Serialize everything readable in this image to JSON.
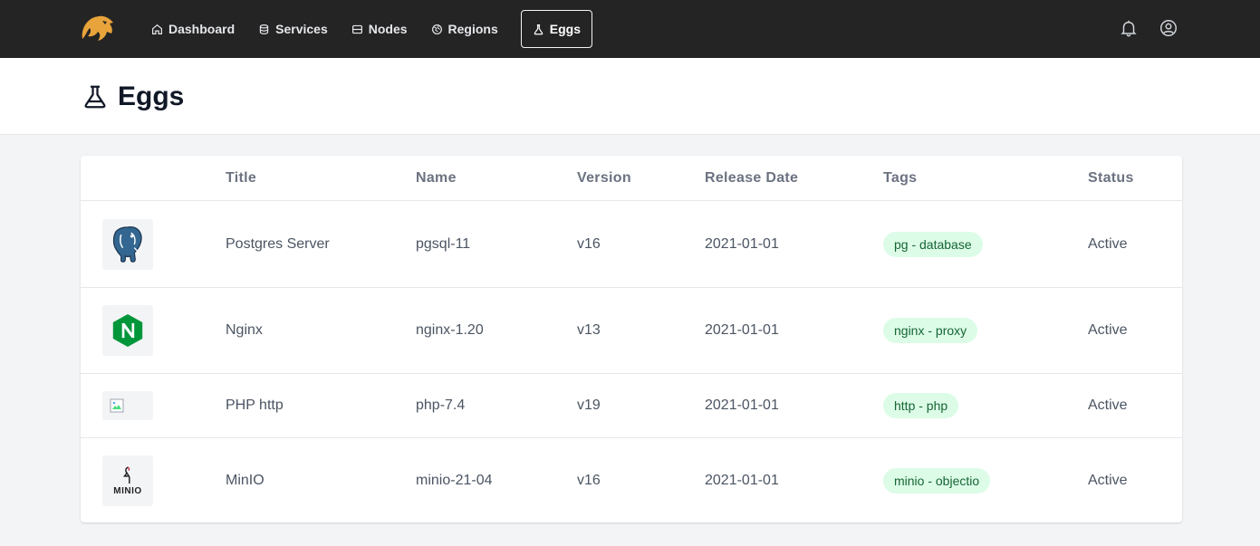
{
  "nav": {
    "logo_icon": "lion-logo-icon",
    "items": [
      {
        "label": "Dashboard",
        "icon": "home-icon"
      },
      {
        "label": "Services",
        "icon": "database-icon"
      },
      {
        "label": "Nodes",
        "icon": "server-icon"
      },
      {
        "label": "Regions",
        "icon": "globe-icon"
      },
      {
        "label": "Eggs",
        "icon": "flask-icon",
        "active": true
      }
    ],
    "right_icons": [
      "bell-icon",
      "user-circle-icon"
    ]
  },
  "page": {
    "title": "Eggs",
    "title_icon": "flask-icon"
  },
  "table": {
    "headers": {
      "title": "Title",
      "name": "Name",
      "version": "Version",
      "release_date": "Release Date",
      "tags": "Tags",
      "status": "Status"
    },
    "rows": [
      {
        "icon": "postgres-elephant-icon",
        "title": "Postgres Server",
        "name": "pgsql-11",
        "version": "v16",
        "release_date": "2021-01-01",
        "tag": "pg - database",
        "status": "Active"
      },
      {
        "icon": "nginx-logo-icon",
        "title": "Nginx",
        "name": "nginx-1.20",
        "version": "v13",
        "release_date": "2021-01-01",
        "tag": "nginx - proxy",
        "status": "Active"
      },
      {
        "icon": "broken-image-icon",
        "title": "PHP http",
        "name": "php-7.4",
        "version": "v19",
        "release_date": "2021-01-01",
        "tag": "http - php",
        "status": "Active"
      },
      {
        "icon": "minio-logo-icon",
        "title": "MinIO",
        "name": "minio-21-04",
        "version": "v16",
        "release_date": "2021-01-01",
        "tag": "minio - objectio",
        "status": "Active",
        "logo_text": "MINIO"
      }
    ]
  },
  "colors": {
    "navbar": "#242424",
    "tag_bg": "#dcfce7",
    "tag_text": "#166534",
    "logo": "#e8a33a"
  }
}
